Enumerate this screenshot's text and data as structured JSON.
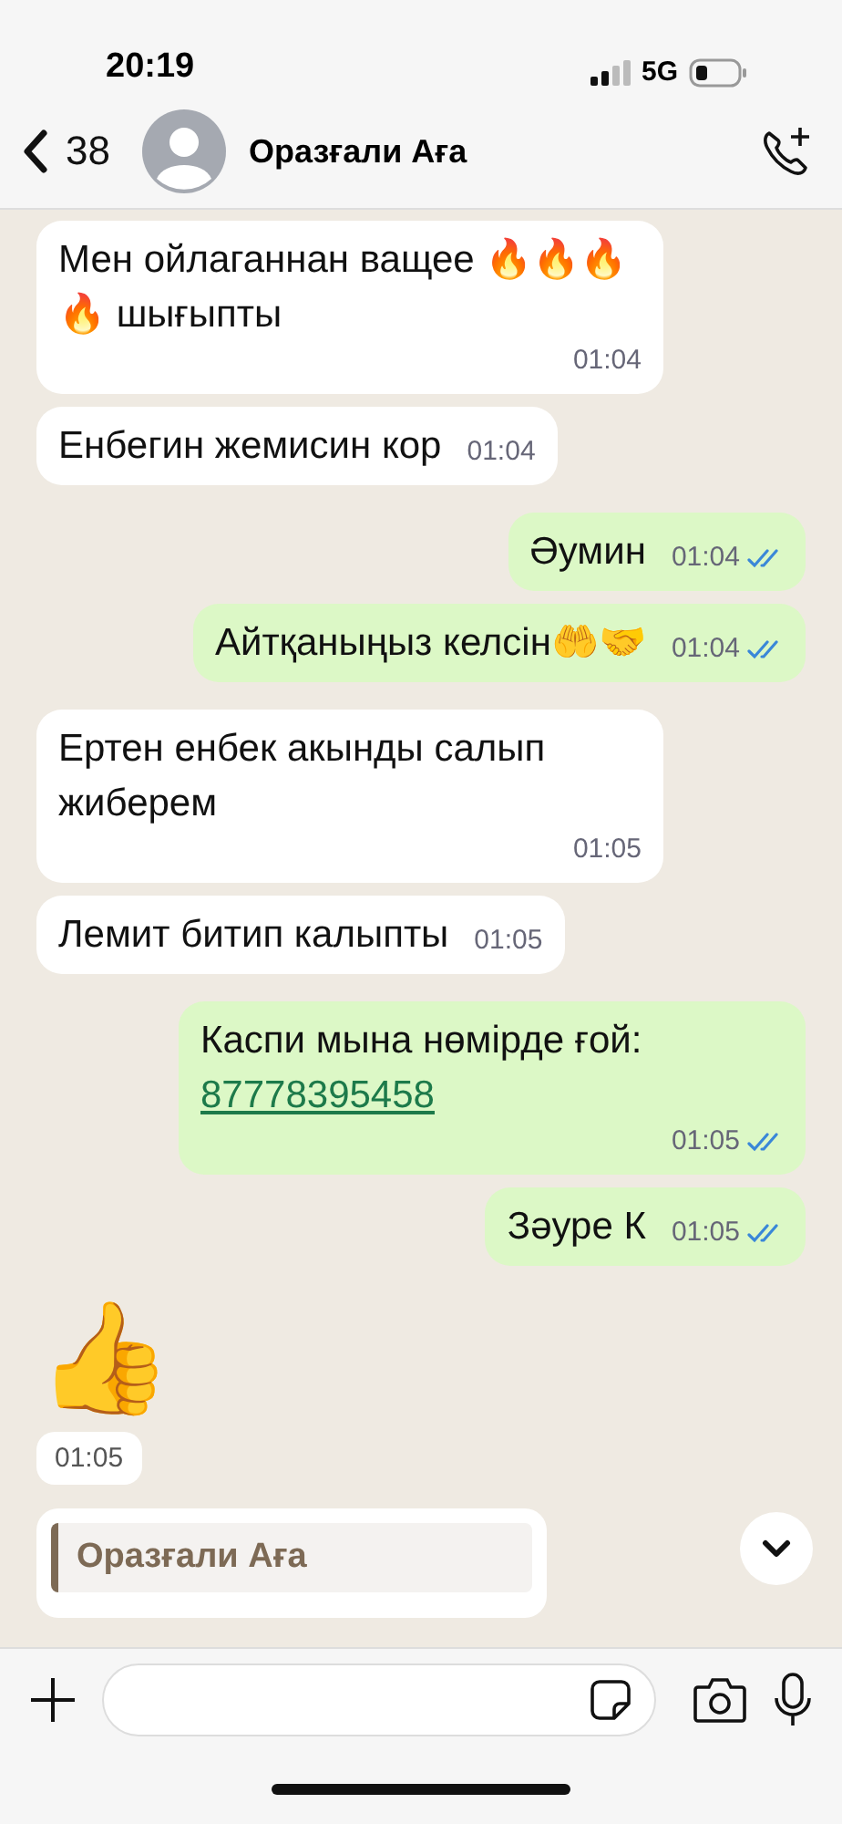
{
  "status_bar": {
    "time": "20:19",
    "network": "5G"
  },
  "header": {
    "back_count": "38",
    "contact_name": "Оразғали Аға"
  },
  "messages": [
    {
      "kind": "text",
      "outgoing": false,
      "text": "Мен ойлаганнан ващее 🔥🔥🔥🔥 шығыпты",
      "time": "01:04"
    },
    {
      "kind": "text",
      "outgoing": false,
      "text": "Енбегин жемисин кор",
      "time": "01:04"
    },
    {
      "kind": "text",
      "outgoing": true,
      "text": "Әумин",
      "time": "01:04",
      "read": true
    },
    {
      "kind": "text",
      "outgoing": true,
      "text": "Айтқаныңыз келсін🤲🤝",
      "time": "01:04",
      "read": true
    },
    {
      "kind": "text",
      "outgoing": false,
      "text": "Ертен енбек акынды салып жиберем",
      "time": "01:05"
    },
    {
      "kind": "text",
      "outgoing": false,
      "text": "Лемит битип калыпты",
      "time": "01:05"
    },
    {
      "kind": "text",
      "outgoing": true,
      "text": "Каспи мына нөмірде ғой:",
      "link": "87778395458",
      "time": "01:05",
      "read": true
    },
    {
      "kind": "text",
      "outgoing": true,
      "text": "Зәуре К",
      "time": "01:05",
      "read": true
    },
    {
      "kind": "emoji",
      "outgoing": false,
      "text": "👍",
      "time": "01:05"
    },
    {
      "kind": "quote",
      "outgoing": false,
      "author": "Оразғали Аға"
    }
  ]
}
